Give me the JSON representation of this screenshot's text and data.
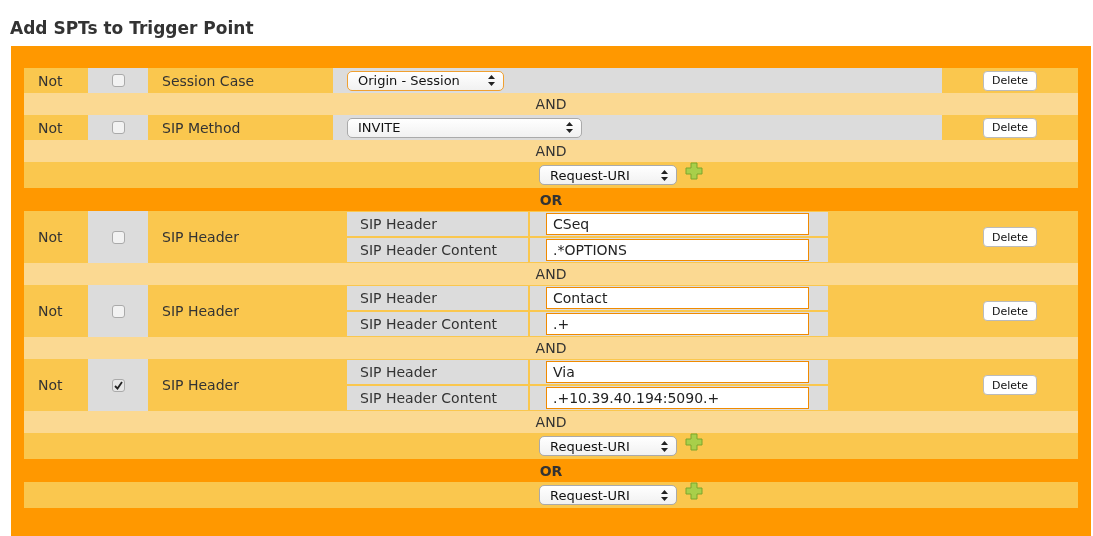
{
  "title": "Add SPTs to Trigger Point",
  "rows": [
    {
      "kind": "spt",
      "not_label": "Not",
      "negated": false,
      "type": "Session Case",
      "select": {
        "value": "Origin - Session",
        "focused": true
      },
      "delete": "Delete"
    },
    {
      "kind": "and",
      "text": "AND"
    },
    {
      "kind": "spt",
      "not_label": "Not",
      "negated": false,
      "type": "SIP Method",
      "select": {
        "value": "INVITE",
        "focused": false
      },
      "delete": "Delete"
    },
    {
      "kind": "and",
      "text": "AND"
    },
    {
      "kind": "add",
      "select": {
        "value": "Request-URI",
        "focused": false
      }
    },
    {
      "kind": "or",
      "text": "OR"
    },
    {
      "kind": "header",
      "not_label": "Not",
      "negated": false,
      "type": "SIP Header",
      "fields": [
        {
          "label": "SIP Header",
          "value": "CSeq"
        },
        {
          "label": "SIP Header Content",
          "value": ".*OPTIONS"
        }
      ],
      "delete": "Delete"
    },
    {
      "kind": "and",
      "text": "AND"
    },
    {
      "kind": "header",
      "not_label": "Not",
      "negated": false,
      "type": "SIP Header",
      "fields": [
        {
          "label": "SIP Header",
          "value": "Contact"
        },
        {
          "label": "SIP Header Content",
          "value": ".+"
        }
      ],
      "delete": "Delete"
    },
    {
      "kind": "and",
      "text": "AND"
    },
    {
      "kind": "header",
      "not_label": "Not",
      "negated": true,
      "type": "SIP Header",
      "fields": [
        {
          "label": "SIP Header",
          "value": "Via"
        },
        {
          "label": "SIP Header Content",
          "value": ".+10.39.40.194:5090.+"
        }
      ],
      "delete": "Delete"
    },
    {
      "kind": "and",
      "text": "AND"
    },
    {
      "kind": "add",
      "select": {
        "value": "Request-URI",
        "focused": false
      }
    },
    {
      "kind": "or",
      "text": "OR"
    },
    {
      "kind": "add",
      "select": {
        "value": "Request-URI",
        "focused": false
      }
    }
  ]
}
